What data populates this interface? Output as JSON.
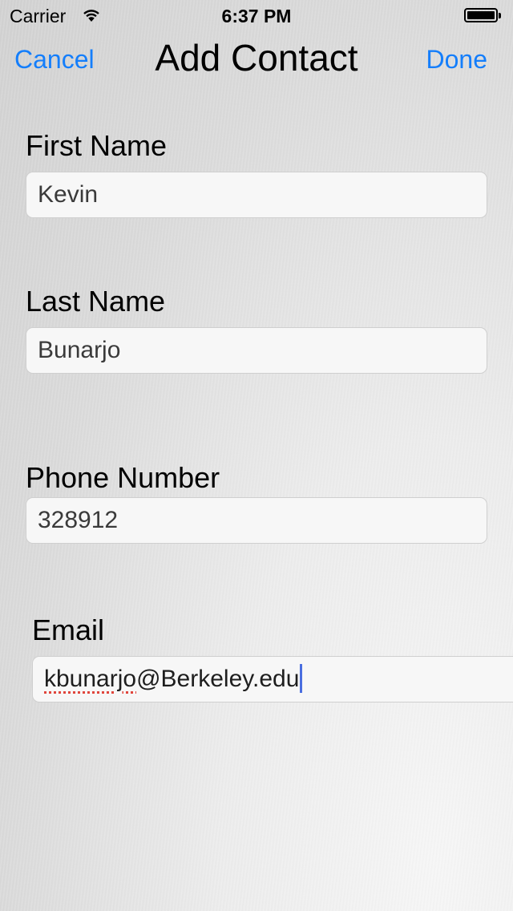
{
  "status_bar": {
    "carrier": "Carrier",
    "time": "6:37 PM",
    "wifi_icon": "wifi-icon",
    "battery_icon": "battery-icon",
    "battery_level": 1.0
  },
  "nav": {
    "cancel_label": "Cancel",
    "title": "Add Contact",
    "done_label": "Done",
    "accent_color": "#147efb"
  },
  "form": {
    "first_name": {
      "label": "First Name",
      "value": "Kevin"
    },
    "last_name": {
      "label": "Last Name",
      "value": "Bunarjo"
    },
    "phone": {
      "label": "Phone Number",
      "value": "328912"
    },
    "email": {
      "label": "Email",
      "value_misspelled_part": "kbunarjo",
      "value_rest": "@Berkeley.edu",
      "focused": true
    }
  }
}
